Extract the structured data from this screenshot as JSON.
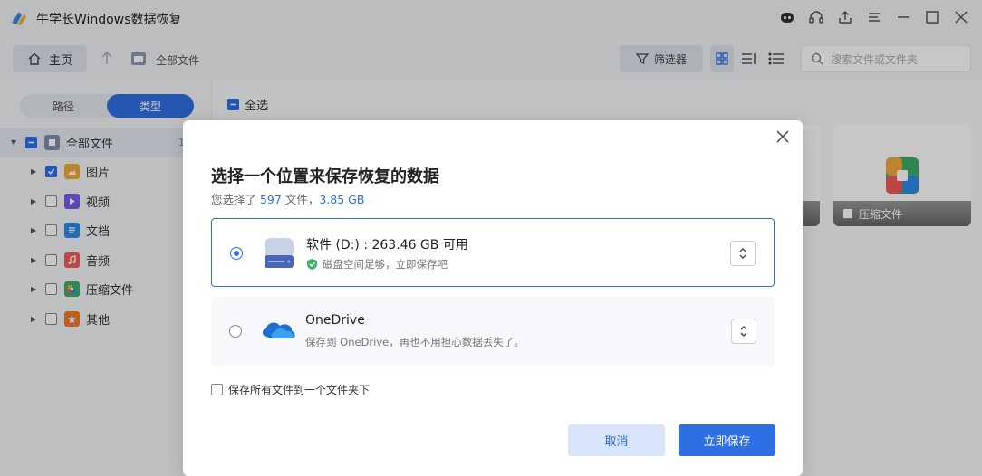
{
  "app": {
    "title": "牛学长Windows数据恢复"
  },
  "toolbar": {
    "home_label": "主页",
    "breadcrumb": "全部文件",
    "filter_label": "筛选器",
    "search_placeholder": "搜索文件或文件夹"
  },
  "sidebar": {
    "seg_path": "路径",
    "seg_type": "类型",
    "root_label": "全部文件",
    "root_count": "1",
    "items": [
      {
        "label": "图片",
        "checked": true,
        "icon": "image-icon",
        "color": "#f2a93b"
      },
      {
        "label": "视频",
        "checked": false,
        "icon": "video-icon",
        "color": "#7a5be3"
      },
      {
        "label": "文档",
        "checked": false,
        "icon": "document-icon",
        "color": "#2f8be4"
      },
      {
        "label": "音频",
        "checked": false,
        "icon": "music-icon",
        "color": "#ef5a5a"
      },
      {
        "label": "压缩文件",
        "checked": false,
        "icon": "archive-icon",
        "color": "#3fae6a"
      },
      {
        "label": "其他",
        "checked": false,
        "icon": "other-icon",
        "color": "#f07a2c"
      }
    ]
  },
  "main": {
    "select_all": "全选",
    "tile_archive": "压缩文件"
  },
  "dialog": {
    "title": "选择一个位置来保存恢复的数据",
    "sub_prefix": "您选择了 ",
    "sub_count": "597",
    "sub_mid": " 文件，",
    "sub_size": "3.85 GB",
    "option1_title": "软件 (D:) : 263.46 GB 可用",
    "option1_desc": "磁盘空间足够，立即保存吧",
    "option2_title": "OneDrive",
    "option2_desc": "保存到 OneDrive，再也不用担心数据丢失了。",
    "save_all_label": "保存所有文件到一个文件夹下",
    "cancel_label": "取消",
    "save_label": "立即保存"
  },
  "colors": {
    "accent": "#2f6fe4",
    "ok": "#3ab36a"
  }
}
